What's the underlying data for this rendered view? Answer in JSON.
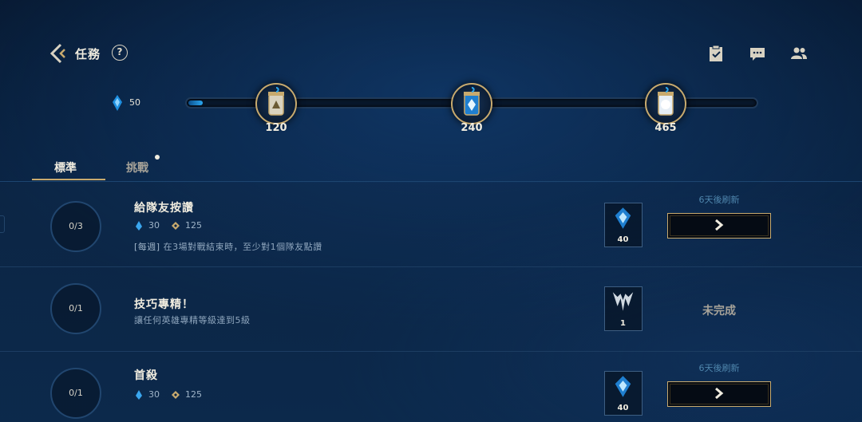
{
  "header": {
    "title": "任務",
    "help_label": "?"
  },
  "track": {
    "current": 50,
    "current_label": "50",
    "max": 465,
    "milestones": [
      {
        "value": 120,
        "label": "120"
      },
      {
        "value": 240,
        "label": "240"
      },
      {
        "value": 465,
        "label": "465"
      }
    ]
  },
  "tabs": [
    {
      "label": "標準",
      "active": true
    },
    {
      "label": "挑戰",
      "active": false,
      "has_notification": true
    }
  ],
  "quests": [
    {
      "progress": "0/3",
      "title": "給隊友按讚",
      "essence": "30",
      "gold": "125",
      "desc_tag": "[每週]",
      "desc": "在3場對戰結束時，至少對1個隊友點讚",
      "reward_icon": "blue-essence-crest-icon",
      "reward_count": "40",
      "refresh": "6天後刷新",
      "state": "go"
    },
    {
      "progress": "0/1",
      "title": "技巧專精！",
      "desc": "讓任何英雄專精等級達到5級",
      "reward_icon": "mastery-crest-icon",
      "reward_count": "1",
      "status": "未完成",
      "state": "incomplete"
    },
    {
      "progress": "0/1",
      "title": "首殺",
      "essence": "30",
      "gold": "125",
      "reward_icon": "blue-essence-crest-icon",
      "reward_count": "40",
      "refresh": "6天後刷新",
      "state": "go"
    }
  ],
  "colors": {
    "gold": "#c8aa6e",
    "accent_blue": "#2aa7f0",
    "refresh_text": "#4f86ad"
  }
}
